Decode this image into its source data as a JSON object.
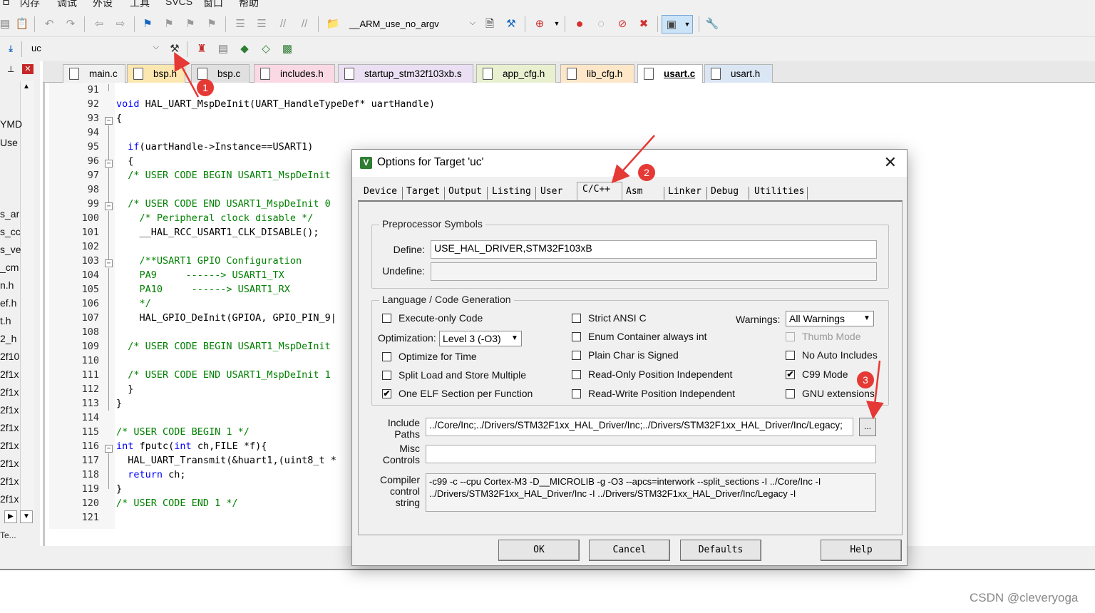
{
  "menubar": {
    "items": [
      "ㅁ",
      "闪存",
      "调试",
      "外设",
      "工具",
      "SVCS",
      "窗口",
      "帮助"
    ]
  },
  "toolbar1": {
    "target_combo": "__ARM_use_no_argv"
  },
  "toolbar2": {
    "target_select": "uc"
  },
  "left_panel": {
    "items": [
      "YMD",
      "Use",
      "s_ar",
      "s_cc",
      "s_ve",
      "_cm",
      "n.h",
      "ef.h",
      "t.h",
      "2_h",
      "2f10",
      "2f1x",
      "2f1x",
      "2f1x",
      "2f1x",
      "2f1x",
      "2f1x",
      "2f1x",
      "2f1x"
    ],
    "footer": "Te..."
  },
  "tabs": [
    "main.c",
    "bsp.h",
    "bsp.c",
    "includes.h",
    "startup_stm32f103xb.s",
    "app_cfg.h",
    "lib_cfg.h",
    "usart.c",
    "usart.h"
  ],
  "active_tab": "usart.c",
  "editor": {
    "line_numbers": [
      "91",
      "92",
      "93",
      "94",
      "95",
      "96",
      "97",
      "98",
      "99",
      "100",
      "101",
      "102",
      "103",
      "104",
      "105",
      "106",
      "107",
      "108",
      "109",
      "110",
      "111",
      "112",
      "113",
      "114",
      "115",
      "116",
      "117",
      "118",
      "119",
      "120",
      "121"
    ],
    "lines": [
      "",
      "void HAL_UART_MspDeInit(UART_HandleTypeDef* uartHandle)",
      "{",
      "",
      "  if(uartHandle->Instance==USART1)",
      "  {",
      "  /* USER CODE BEGIN USART1_MspDeInit",
      "",
      "  /* USER CODE END USART1_MspDeInit 0",
      "    /* Peripheral clock disable */",
      "    __HAL_RCC_USART1_CLK_DISABLE();",
      "",
      "    /**USART1 GPIO Configuration",
      "    PA9     ------> USART1_TX",
      "    PA10     ------> USART1_RX",
      "    */",
      "    HAL_GPIO_DeInit(GPIOA, GPIO_PIN_9|",
      "",
      "  /* USER CODE BEGIN USART1_MspDeInit",
      "",
      "  /* USER CODE END USART1_MspDeInit 1",
      "  }",
      "}",
      "",
      "/* USER CODE BEGIN 1 */",
      "int fputc(int ch,FILE *f){",
      "  HAL_UART_Transmit(&huart1,(uint8_t *",
      "  return ch;",
      "}",
      "/* USER CODE END 1 */",
      ""
    ]
  },
  "dialog": {
    "title": "Options for Target 'uc'",
    "close": "✕",
    "tabs": [
      "Device",
      "Target",
      "Output",
      "Listing",
      "User",
      "C/C++",
      "Asm",
      "Linker",
      "Debug",
      "Utilities"
    ],
    "active_tab": "C/C++",
    "preprocessor": {
      "group_title": "Preprocessor Symbols",
      "define_label": "Define:",
      "define_value": "USE_HAL_DRIVER,STM32F103xB",
      "undefine_label": "Undefine:",
      "undefine_value": ""
    },
    "language": {
      "group_title": "Language / Code Generation",
      "execute_only": "Execute-only Code",
      "optimization_label": "Optimization:",
      "optimization_value": "Level 3 (-O3)",
      "optimize_time": "Optimize for Time",
      "split_load": "Split Load and Store Multiple",
      "one_elf": "One ELF Section per Function",
      "strict_ansi": "Strict ANSI C",
      "enum_container": "Enum Container always int",
      "plain_char": "Plain Char is Signed",
      "ro_pi": "Read-Only Position Independent",
      "rw_pi": "Read-Write Position Independent",
      "warnings_label": "Warnings:",
      "warnings_value": "All Warnings",
      "thumb_mode": "Thumb Mode",
      "no_auto_includes": "No Auto Includes",
      "c99_mode": "C99 Mode",
      "gnu_ext": "GNU extensions",
      "checked_mark": "✔"
    },
    "include_label_1": "Include",
    "include_label_2": "Paths",
    "include_value": "../Core/Inc;../Drivers/STM32F1xx_HAL_Driver/Inc;../Drivers/STM32F1xx_HAL_Driver/Inc/Legacy;",
    "browse_label": "...",
    "misc_label_1": "Misc",
    "misc_label_2": "Controls",
    "misc_value": "",
    "compiler_label_1": "Compiler",
    "compiler_label_2": "control",
    "compiler_label_3": "string",
    "compiler_line_1": "-c99 -c --cpu Cortex-M3 -D__MICROLIB -g -O3 --apcs=interwork --split_sections -I ../Core/Inc -I",
    "compiler_line_2": "../Drivers/STM32F1xx_HAL_Driver/Inc -I ../Drivers/STM32F1xx_HAL_Driver/Inc/Legacy -I",
    "buttons": {
      "ok": "OK",
      "cancel": "Cancel",
      "defaults": "Defaults",
      "help": "Help"
    }
  },
  "annotations": {
    "badge1": "1",
    "badge2": "2",
    "badge3": "3",
    "arrow_color": "#e53935"
  },
  "watermark": "CSDN @cleveryoga",
  "colors": {
    "keyword": "#0000ff",
    "comment": "#008000"
  }
}
